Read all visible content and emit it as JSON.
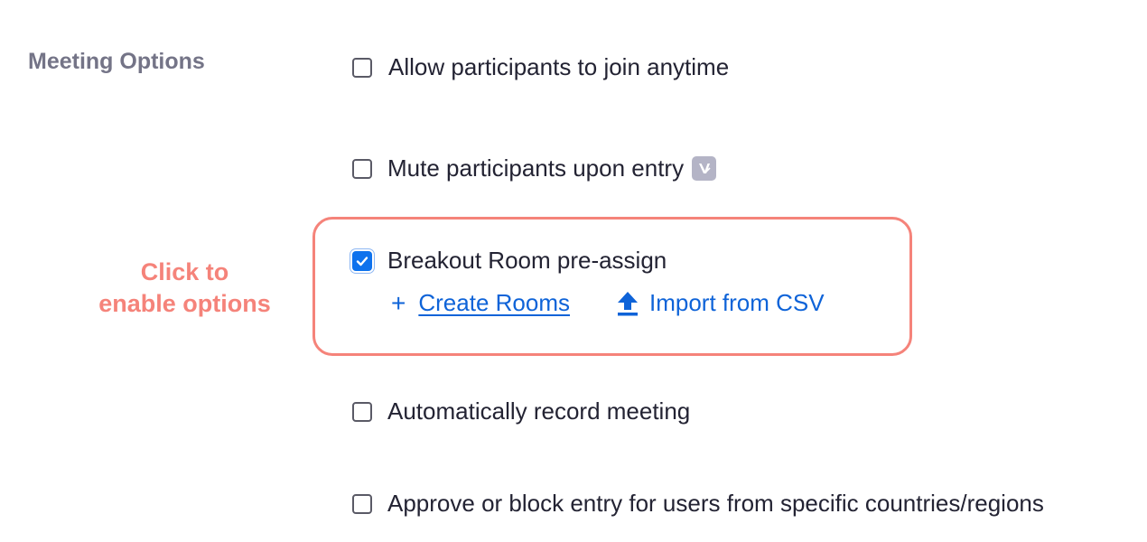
{
  "section": {
    "label": "Meeting Options"
  },
  "annotation": {
    "line1": "Click to",
    "line2": "enable options"
  },
  "options": [
    {
      "label": "Allow participants to join anytime",
      "checked": false
    },
    {
      "label": "Mute participants upon entry",
      "checked": false,
      "badge_icon": "v-badge-icon"
    },
    {
      "label": "Breakout Room pre-assign",
      "checked": true
    },
    {
      "label": "Automatically record meeting",
      "checked": false
    },
    {
      "label": "Approve or block entry for users from specific countries/regions",
      "checked": false
    }
  ],
  "breakout_actions": {
    "create_label": "Create Rooms",
    "create_icon": "plus-icon",
    "import_label": "Import from CSV",
    "import_icon": "upload-icon"
  },
  "colors": {
    "accent": "#0e72ed",
    "link": "#0e63d8",
    "annotation": "#f5837a",
    "section_label": "#747487",
    "badge": "#b4b4c6"
  }
}
